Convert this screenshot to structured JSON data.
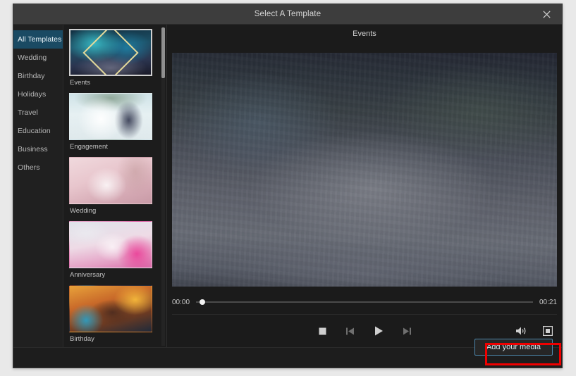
{
  "window": {
    "title": "Select A Template",
    "close_icon": "close-icon"
  },
  "sidebar": {
    "items": [
      {
        "label": "All Templates",
        "active": true
      },
      {
        "label": "Wedding",
        "active": false
      },
      {
        "label": "Birthday",
        "active": false
      },
      {
        "label": "Holidays",
        "active": false
      },
      {
        "label": "Travel",
        "active": false
      },
      {
        "label": "Education",
        "active": false
      },
      {
        "label": "Business",
        "active": false
      },
      {
        "label": "Others",
        "active": false
      }
    ]
  },
  "templates": {
    "items": [
      {
        "label": "Events",
        "art": "art-events",
        "selected": true
      },
      {
        "label": "Engagement",
        "art": "art-engagement",
        "selected": false
      },
      {
        "label": "Wedding",
        "art": "art-wedding",
        "selected": false
      },
      {
        "label": "Anniversary",
        "art": "art-anniversary",
        "selected": false
      },
      {
        "label": "Birthday",
        "art": "art-birthday",
        "selected": false
      }
    ]
  },
  "preview": {
    "title": "Events",
    "current_time": "00:00",
    "total_time": "00:21",
    "playhead_percent": 1,
    "controls": {
      "stop": "stop-icon",
      "step_back": "step-backward-icon",
      "play": "play-icon",
      "step_forward": "step-forward-icon",
      "volume": "volume-icon",
      "fullscreen": "fullscreen-icon"
    }
  },
  "footer": {
    "add_media_label": "Add your media"
  },
  "colors": {
    "accent": "#1a4a63",
    "button_border": "#4d87ab",
    "highlight": "#ef0000",
    "window_bg": "#1d1d1d",
    "titlebar_bg": "#3d3d3d"
  }
}
